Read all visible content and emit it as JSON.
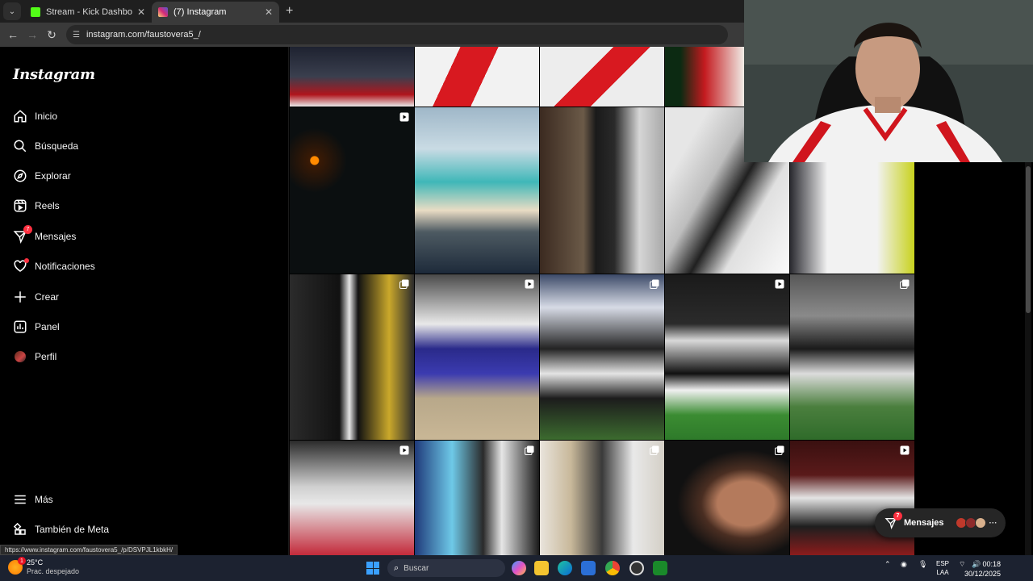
{
  "browser": {
    "tabs": [
      {
        "title": "Stream - Kick Dashboard",
        "active": false,
        "favicon_color": "#53fc18"
      },
      {
        "title": "(7) Instagram",
        "active": true,
        "favicon_color": "#d62976"
      }
    ],
    "url": "instagram.com/faustovera5_/"
  },
  "sidebar": {
    "logo": "Instagram",
    "items": [
      {
        "label": "Inicio",
        "icon": "home-icon"
      },
      {
        "label": "Búsqueda",
        "icon": "search-icon"
      },
      {
        "label": "Explorar",
        "icon": "compass-icon"
      },
      {
        "label": "Reels",
        "icon": "reels-icon"
      },
      {
        "label": "Mensajes",
        "icon": "messenger-icon",
        "badge": "7"
      },
      {
        "label": "Notificaciones",
        "icon": "heart-icon"
      },
      {
        "label": "Crear",
        "icon": "plus-icon"
      },
      {
        "label": "Panel",
        "icon": "chart-icon"
      },
      {
        "label": "Perfil",
        "icon": "avatar"
      }
    ],
    "bottom": [
      {
        "label": "Más",
        "icon": "menu-icon"
      },
      {
        "label": "También de Meta",
        "icon": "meta-apps-icon"
      }
    ]
  },
  "messages_pill": {
    "label": "Mensajes",
    "badge": "7"
  },
  "status_url": "https://www.instagram.com/faustovera5_/p/DSVPJL1kbkH/",
  "taskbar": {
    "weather_temp": "25°C",
    "weather_desc": "Prac. despejado",
    "weather_badge": "1",
    "search_placeholder": "Buscar",
    "lang_top": "ESP",
    "lang_bottom": "LAA",
    "time": "00:18",
    "date": "30/12/2025"
  },
  "colors": {
    "accent_badge": "#ff3040",
    "taskbar_bg": "#1c2230",
    "ig_bg": "#000000"
  }
}
